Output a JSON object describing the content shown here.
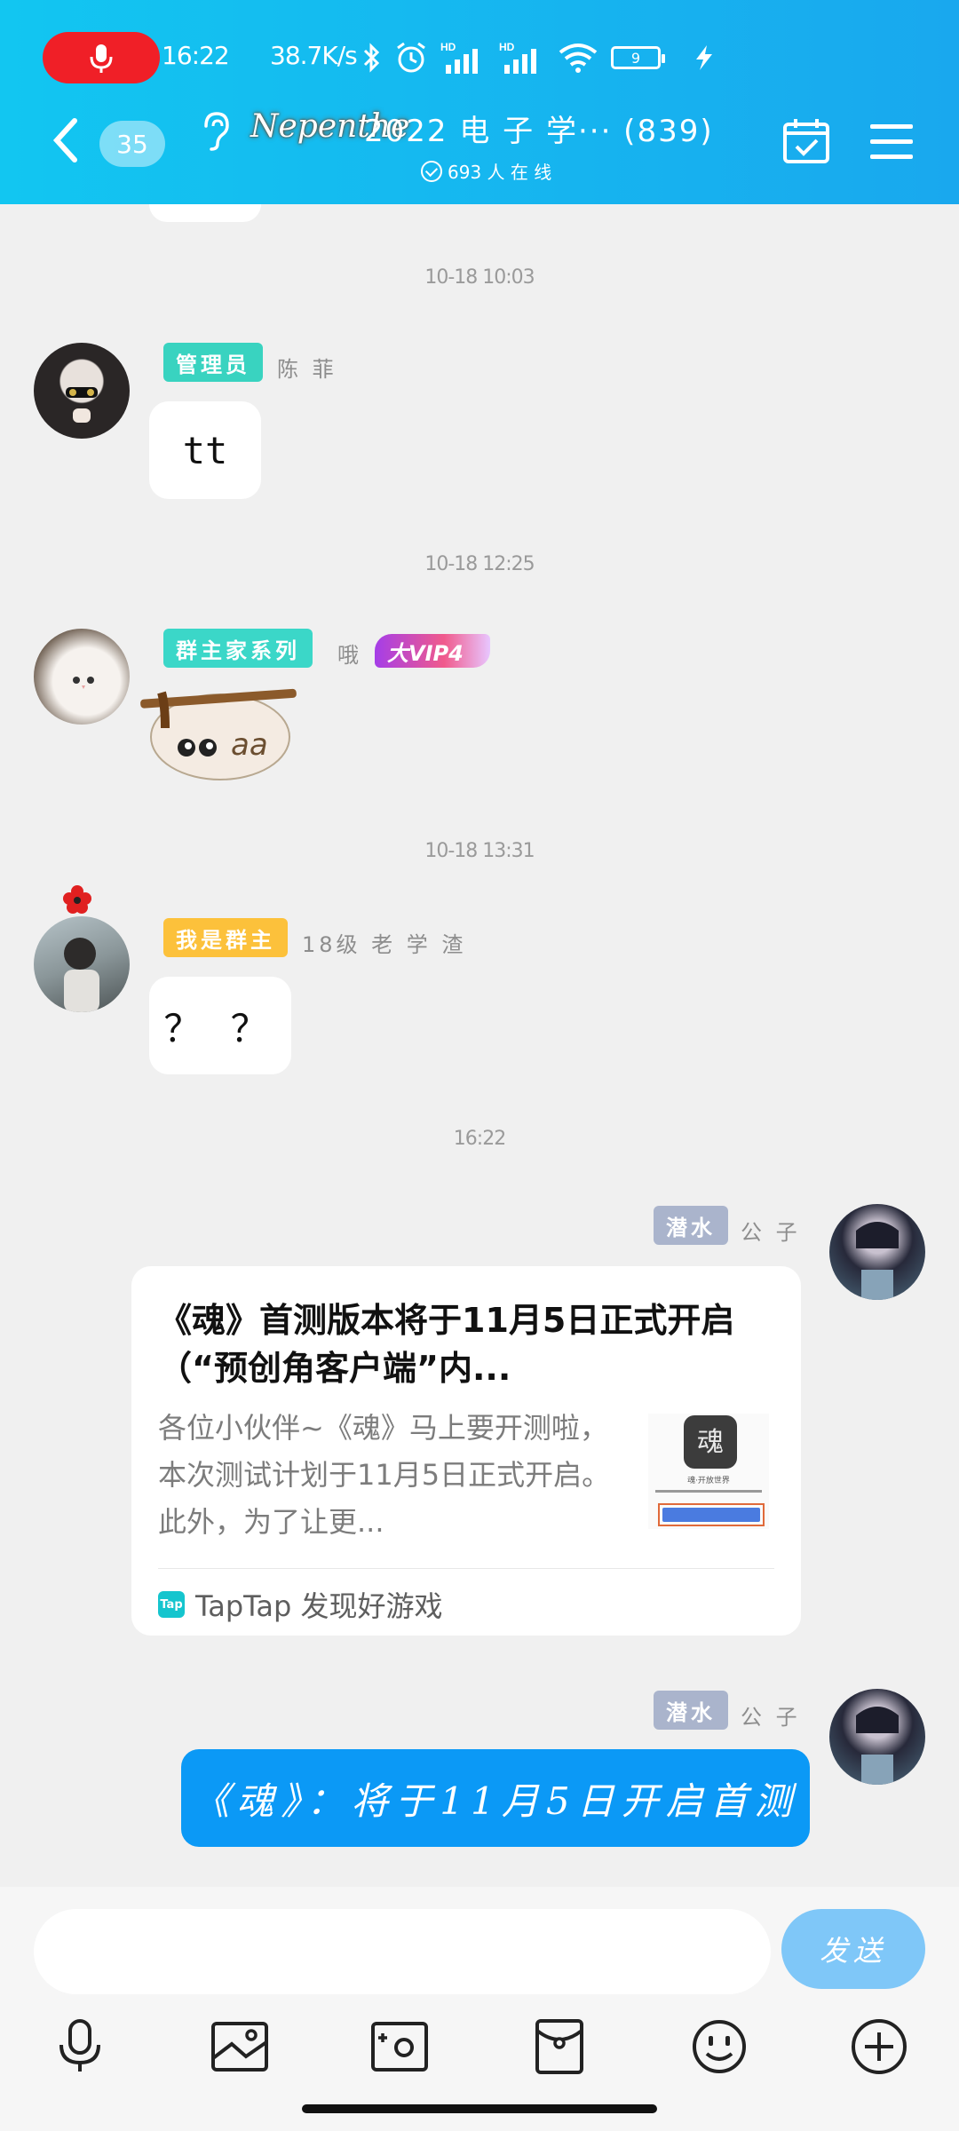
{
  "status_bar": {
    "time": "16:22",
    "net_speed": "38.7K/s",
    "battery": "9"
  },
  "header": {
    "unread_count": "35",
    "logo_text": "Nepenthe",
    "group_title": "2022 电 子 学··· (839)",
    "online_text": "693 人 在 线"
  },
  "messages": [
    {
      "time": "10-18  10:03"
    },
    {
      "tag": "管理员",
      "tag_color": "#39d3c0",
      "nick": "陈 菲",
      "text": "tt"
    },
    {
      "time": "10-18  12:25"
    },
    {
      "tag": "群主家系列",
      "tag_color": "#3bd7c8",
      "nick": "哦",
      "vip": "大VIP4",
      "sticker_text": "aa"
    },
    {
      "time": "10-18  13:31"
    },
    {
      "tag": "我是群主",
      "tag_color": "#fcc13b",
      "nick": "18级 老 学 渣",
      "text": "？ ？"
    },
    {
      "time": "16:22"
    },
    {
      "tag": "潜水",
      "tag_color": "#aab4cc",
      "nick": "公 子",
      "card": {
        "title": "《魂》首测版本将于11月5日正式开启（“预创角客户端”内...",
        "desc": "各位小伙伴~《魂》马上要开测啦，本次测试计划于11月5日正式开启。此外，为了让更...",
        "thumb_caption": "魂·开放世界",
        "source_icon": "Tap",
        "source": "TapTap 发现好游戏"
      }
    },
    {
      "tag": "潜水",
      "tag_color": "#aab4cc",
      "nick": "公 子",
      "text": "《魂》：将于11月5日开启首测"
    }
  ],
  "input": {
    "placeholder": "",
    "send_label": "发送"
  }
}
